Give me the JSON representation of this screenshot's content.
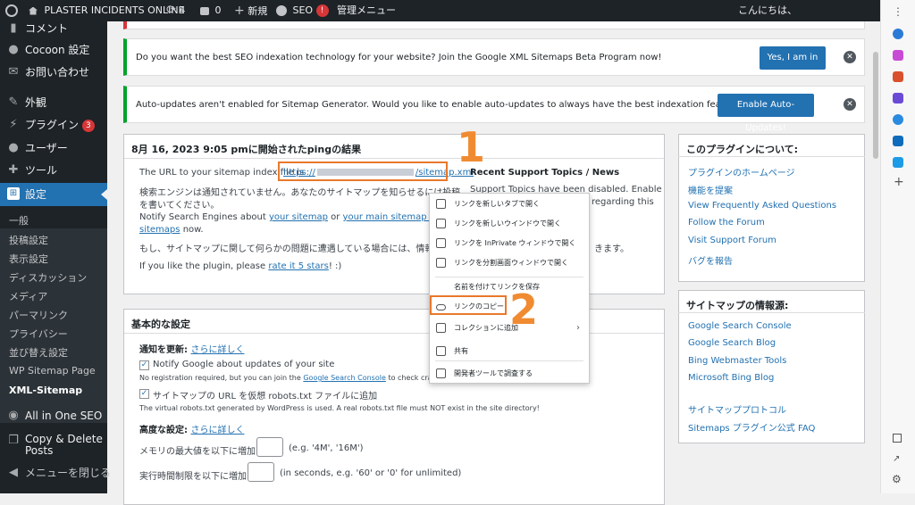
{
  "adminbar": {
    "site_name": "PLASTER INCIDENTS ONLINE",
    "updates_count": "4",
    "comments_count": "0",
    "new_label": "新規",
    "seo_label": "SEO",
    "seo_badge": "!",
    "admin_menu_label": "管理メニュー",
    "greeting": "こんにちは、"
  },
  "sidebar": {
    "items": [
      {
        "label": "コメント",
        "icon": "comment-icon"
      },
      {
        "label": "Cocoon 設定",
        "icon": "cocoon-icon"
      },
      {
        "label": "お問い合わせ",
        "icon": "mail-icon"
      },
      {
        "label": "外観",
        "icon": "brush-icon"
      },
      {
        "label": "プラグイン",
        "icon": "plugin-icon",
        "badge": "3"
      },
      {
        "label": "ユーザー",
        "icon": "user-icon"
      },
      {
        "label": "ツール",
        "icon": "wrench-icon"
      },
      {
        "label": "設定",
        "icon": "settings-icon"
      }
    ],
    "submenu": [
      "一般",
      "投稿設定",
      "表示設定",
      "ディスカッション",
      "メディア",
      "パーマリンク",
      "プライバシー",
      "並び替え設定",
      "WP Sitemap Page",
      "XML-Sitemap"
    ],
    "bottom": [
      {
        "label": "All in One SEO",
        "icon": "aioseo-icon"
      },
      {
        "label": "Copy & Delete",
        "label2": "Posts",
        "icon": "copy-icon"
      },
      {
        "label": "メニューを閉じる",
        "icon": "collapse-icon"
      }
    ]
  },
  "notices": {
    "n1_text": "Do you want the best SEO indexation technology for your website? Join the Google XML Sitemaps Beta Program now!",
    "n1_button": "Yes, I am in",
    "n2_text": "Auto-updates aren't enabled for Sitemap Generator. Would you like to enable auto-updates to always have the best indexation features?",
    "n2_button": "Enable Auto-Updates!"
  },
  "ping_box": {
    "title": "8月 16, 2023 9:05 pmに開始されたpingの結果",
    "url_prefix": "The URL to your sitemap index file is",
    "url_host": "https://",
    "url_suffix": "/sitemap.xml",
    "line2": "検索エンジンは通知されていません。あなたのサイトマップを知らせるには投稿",
    "line3": "を書いてください。",
    "notify_prefix": "Notify Search Engines about",
    "notify_link1": "your sitemap",
    "notify_or": "or",
    "notify_link2": "your main sitemap and all sub",
    "notify_link3": "sitemaps",
    "notify_now": "now.",
    "problem_line": "もし、サイトマップに関して何らかの問題に遭遇している場合には、情報",
    "problem_tail": "きます。",
    "rate_prefix": "If you like the plugin, please",
    "rate_link": "rate it 5 stars",
    "rate_suffix": "! :)",
    "support_title": "Recent Support Topics / News",
    "support_line1": "Support Topics have been disabled. Enable",
    "support_line2": "regarding this"
  },
  "basic": {
    "title": "基本的な設定",
    "notify_label": "通知を更新:",
    "learn_more": "さらに詳しく",
    "cb1_label": "Notify Google about updates of your site",
    "cb1_help_prefix": "No registration required, but you can join the",
    "cb1_help_link": "Google Search Console",
    "cb1_help_suffix": "to check crawling sta",
    "cb2_label": "サイトマップの URL を仮想 robots.txt ファイルに追加",
    "cb2_help": "The virtual robots.txt generated by WordPress is used. A real robots.txt file must NOT exist in the site directory!",
    "advanced_label": "高度な設定:",
    "memory_label": "メモリの最大値を以下に増加:",
    "memory_hint": "(e.g. '4M', '16M')",
    "time_label": "実行時間制限を以下に増加:",
    "time_hint": "(in seconds, e.g. '60' or '0' for unlimited)"
  },
  "about_box": {
    "title": "このプラグインについて:",
    "links": [
      "プラグインのホームページ",
      "機能を提案",
      "View Frequently Asked Questions",
      "Follow the Forum",
      "Visit Support Forum",
      "バグを報告"
    ]
  },
  "sources_box": {
    "title": "サイトマップの情報源:",
    "links": [
      "Google Search Console",
      "Google Search Blog",
      "Bing Webmaster Tools",
      "Microsoft Bing Blog"
    ],
    "links2": [
      "サイトマッププロトコル",
      "Sitemaps プラグイン公式 FAQ"
    ]
  },
  "context_menu": {
    "items": [
      {
        "label": "リンクを新しいタブで開く",
        "icon": "new-tab-icon"
      },
      {
        "label": "リンクを新しいウインドウで開く",
        "icon": "new-window-icon"
      },
      {
        "label": "リンクを InPrivate ウィンドウで開く",
        "icon": "inprivate-icon"
      },
      {
        "label": "リンクを分割画面ウィンドウで開く",
        "icon": "split-screen-icon"
      },
      {
        "label": "名前を付けてリンクを保存",
        "icon": ""
      },
      {
        "label": "リンクのコピー",
        "icon": "link-icon"
      },
      {
        "label": "コレクションに追加",
        "icon": "collection-icon"
      },
      {
        "label": "共有",
        "icon": "share-icon"
      },
      {
        "label": "開発者ツールで調査する",
        "icon": "devtools-icon"
      }
    ]
  },
  "annotations": {
    "step1": "1",
    "step2": "2"
  },
  "colors": {
    "accent": "#2271b1",
    "annotation": "#e8792b",
    "notice_border": "#00a32a",
    "admin_bg": "#1d2327"
  }
}
